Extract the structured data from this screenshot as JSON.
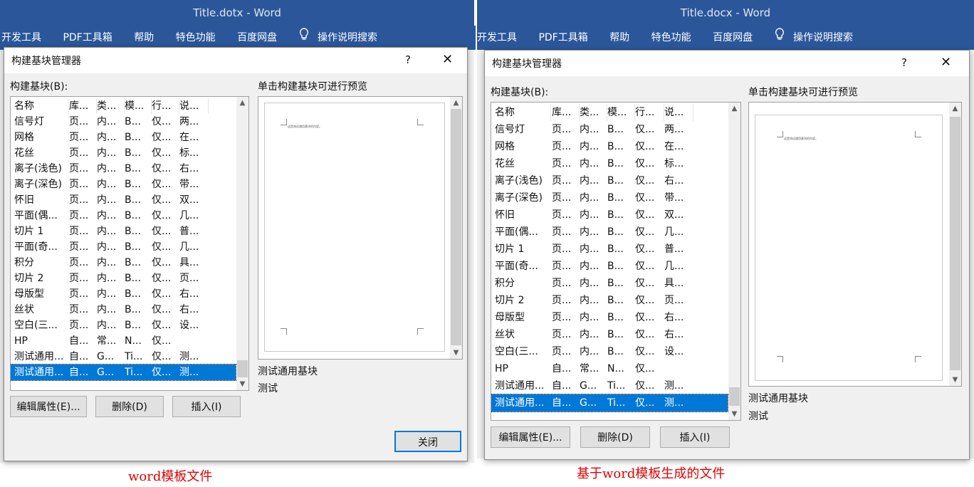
{
  "left": {
    "window_title": "Title.dotx  -  Word",
    "caption": "word模板文件"
  },
  "right": {
    "window_title": "Title.docx  -  Word",
    "caption": "基于word模板生成的文件"
  },
  "ribbon": {
    "tabs": [
      "开发工具",
      "PDF工具箱",
      "帮助",
      "特色功能",
      "百度网盘",
      "操作说明搜索"
    ]
  },
  "dialog": {
    "title": "构建基块管理器",
    "help": "?",
    "close_symbol": "✕",
    "list_label": "构建基块(B):",
    "preview_label": "单击构建基块可进行预览",
    "columns": [
      "名称",
      "库...",
      "类...",
      "模...",
      "行...",
      "说..."
    ],
    "rows": [
      [
        "信号灯",
        "页...",
        "内...",
        "B...",
        "仅...",
        "两..."
      ],
      [
        "网格",
        "页...",
        "内...",
        "B...",
        "仅...",
        "在..."
      ],
      [
        "花丝",
        "页...",
        "内...",
        "B...",
        "仅...",
        "标..."
      ],
      [
        "离子(浅色)",
        "页...",
        "内...",
        "B...",
        "仅...",
        "右..."
      ],
      [
        "离子(深色)",
        "页...",
        "内...",
        "B...",
        "仅...",
        "带..."
      ],
      [
        "怀旧",
        "页...",
        "内...",
        "B...",
        "仅...",
        "双..."
      ],
      [
        "平面(偶...",
        "页...",
        "内...",
        "B...",
        "仅...",
        "几..."
      ],
      [
        "切片 1",
        "页...",
        "内...",
        "B...",
        "仅...",
        "普..."
      ],
      [
        "平面(奇...",
        "页...",
        "内...",
        "B...",
        "仅...",
        "几..."
      ],
      [
        "积分",
        "页...",
        "内...",
        "B...",
        "仅...",
        "具..."
      ],
      [
        "切片 2",
        "页...",
        "内...",
        "B...",
        "仅...",
        "页..."
      ],
      [
        "母版型",
        "页...",
        "内...",
        "B...",
        "仅...",
        "右..."
      ],
      [
        "丝状",
        "页...",
        "内...",
        "B...",
        "仅...",
        "右..."
      ],
      [
        " 空白(三...",
        "页...",
        "内...",
        "B...",
        "仅...",
        "设..."
      ],
      [
        "HP",
        "自...",
        "常...",
        "N...",
        "仅...",
        ""
      ],
      [
        "测试通用...",
        "自...",
        "G...",
        "Ti...",
        "仅...",
        "测..."
      ],
      [
        "测试通用...",
        "自...",
        "G...",
        "Ti...",
        "仅...",
        "测..."
      ]
    ],
    "preview_page_text": "这是测试通用基块的内容。",
    "preview_name": "测试通用基块",
    "preview_desc": "测试",
    "buttons": {
      "edit": "编辑属性(E)...",
      "delete": "删除(D)",
      "insert": "插入(I)",
      "close": "关闭"
    }
  }
}
